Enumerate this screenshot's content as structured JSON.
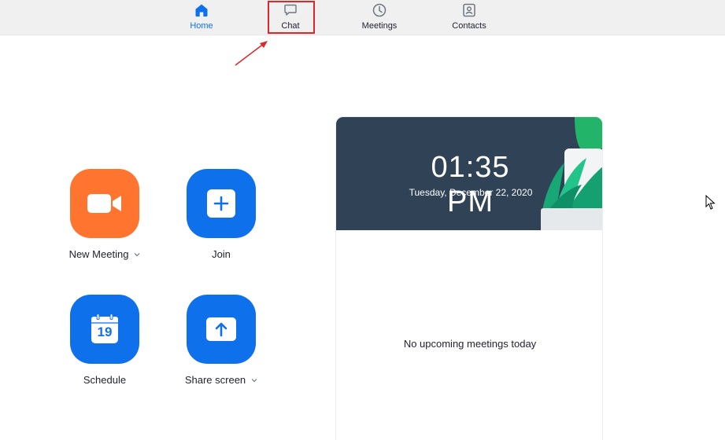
{
  "nav": {
    "tabs": [
      {
        "label": "Home",
        "icon": "home-icon",
        "active": true
      },
      {
        "label": "Chat",
        "icon": "chat-icon",
        "active": false
      },
      {
        "label": "Meetings",
        "icon": "clock-icon",
        "active": false
      },
      {
        "label": "Contacts",
        "icon": "contact-card-icon",
        "active": false
      }
    ]
  },
  "actions": {
    "new_meeting": {
      "label": "New Meeting",
      "icon": "video-camera-icon",
      "color": "#ff742e"
    },
    "join": {
      "label": "Join",
      "icon": "plus-icon",
      "color": "#0e71eb"
    },
    "schedule": {
      "label": "Schedule",
      "icon": "calendar-icon",
      "day": "19",
      "color": "#0e71eb"
    },
    "share_screen": {
      "label": "Share screen",
      "icon": "upload-arrow-icon",
      "color": "#0e71eb"
    }
  },
  "calendar": {
    "time": "01:35 PM",
    "date": "Tuesday, December 22, 2020",
    "empty_message": "No upcoming meetings today"
  },
  "colors": {
    "accent": "#0e71eb",
    "highlight": "#e0252b",
    "banner": "#2f4256"
  }
}
